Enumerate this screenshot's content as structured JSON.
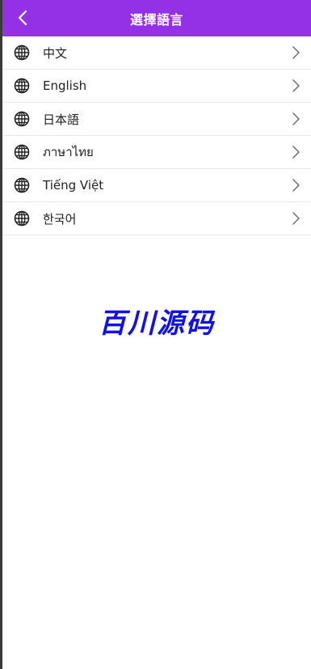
{
  "header": {
    "title": "選擇語言",
    "back_icon": "chevron-left-icon",
    "background": "#9430e6"
  },
  "languages": [
    {
      "label": "中文",
      "icon": "globe-icon"
    },
    {
      "label": "English",
      "icon": "globe-icon"
    },
    {
      "label": "日本語",
      "icon": "globe-icon"
    },
    {
      "label": "ภาษาไทย",
      "icon": "globe-icon"
    },
    {
      "label": "Tiếng Việt",
      "icon": "globe-icon"
    },
    {
      "label": "한국어",
      "icon": "globe-icon"
    }
  ],
  "watermark": {
    "text": "百川源码",
    "color": "#1010ee"
  }
}
